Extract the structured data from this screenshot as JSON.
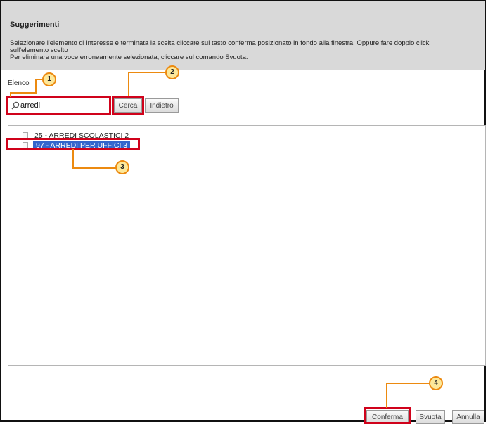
{
  "dialog": {
    "title": "Suggerimenti",
    "instructions": [
      "Selezionare l'elemento di interesse e terminata la scelta cliccare sul tasto conferma posizionato in fondo alla finestra. Oppure fare doppio click",
      "sull'elemento scelto",
      "Per eliminare una voce erroneamente selezionata, cliccare sul comando Svuota."
    ]
  },
  "list": {
    "label": "Elenco"
  },
  "search": {
    "value": "arredi",
    "search_button": "Cerca",
    "back_button": "Indietro"
  },
  "tree": {
    "items": [
      {
        "label": "25 - ARREDI SCOLASTICI 2",
        "selected": false
      },
      {
        "label": "97 - ARREDI PER UFFICI 3",
        "selected": true
      }
    ]
  },
  "footer": {
    "confirm": "Conferma",
    "clear": "Svuota",
    "cancel": "Annulla"
  },
  "callouts": [
    "1",
    "2",
    "3",
    "4"
  ],
  "colors": {
    "highlight": "#d0021b",
    "callout_fill": "#fde89a",
    "callout_stroke": "#ec8a10",
    "selection": "#3366cc",
    "header_bg": "#d9d9d9"
  }
}
